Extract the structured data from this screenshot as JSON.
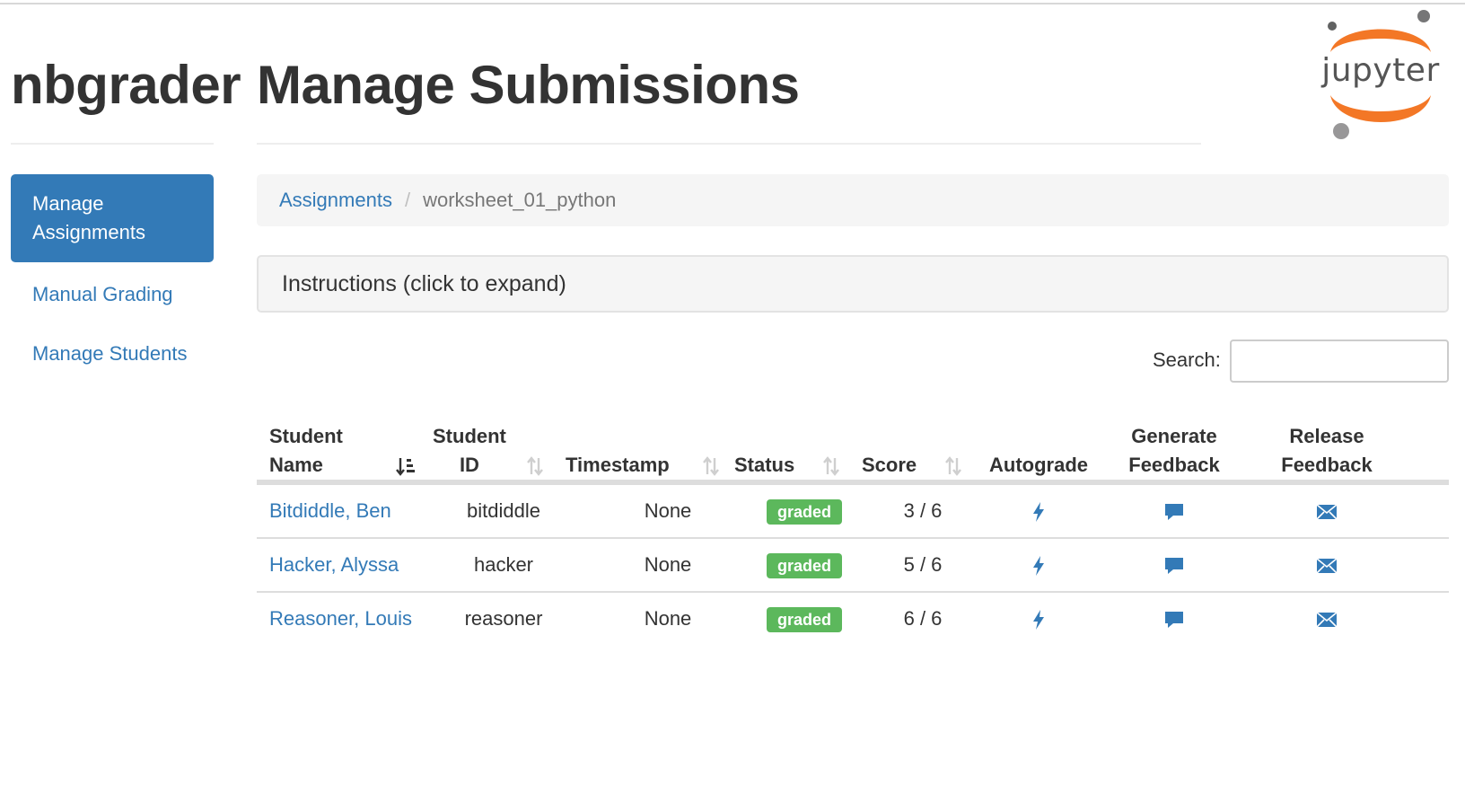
{
  "header": {
    "brand": "nbgrader",
    "title": "Manage Submissions",
    "logo_text": "jupyter"
  },
  "sidebar": {
    "items": [
      {
        "label": "Manage Assignments",
        "active": true
      },
      {
        "label": "Manual Grading",
        "active": false
      },
      {
        "label": "Manage Students",
        "active": false
      }
    ]
  },
  "breadcrumb": {
    "parent": "Assignments",
    "separator": "/",
    "current": "worksheet_01_python"
  },
  "instructions": {
    "label": "Instructions (click to expand)"
  },
  "search": {
    "label": "Search:",
    "value": "",
    "placeholder": ""
  },
  "table": {
    "columns": [
      {
        "label_line1": "Student",
        "label_line2": "Name",
        "sort": "ascending"
      },
      {
        "label_line1": "Student",
        "label_line2": "ID",
        "sort": "sortable"
      },
      {
        "label_line1": "",
        "label_line2": "Timestamp",
        "sort": "sortable"
      },
      {
        "label_line1": "",
        "label_line2": "Status",
        "sort": "sortable"
      },
      {
        "label_line1": "",
        "label_line2": "Score",
        "sort": "sortable"
      },
      {
        "label_line1": "",
        "label_line2": "Autograde",
        "sort": "none"
      },
      {
        "label_line1": "Generate",
        "label_line2": "Feedback",
        "sort": "none"
      },
      {
        "label_line1": "Release",
        "label_line2": "Feedback",
        "sort": "none"
      }
    ],
    "rows": [
      {
        "name": "Bitdiddle, Ben",
        "id": "bitdiddle",
        "timestamp": "None",
        "status": "graded",
        "score": "3 / 6"
      },
      {
        "name": "Hacker, Alyssa",
        "id": "hacker",
        "timestamp": "None",
        "status": "graded",
        "score": "5 / 6"
      },
      {
        "name": "Reasoner, Louis",
        "id": "reasoner",
        "timestamp": "None",
        "status": "graded",
        "score": "6 / 6"
      }
    ],
    "icons": {
      "autograde": "flash-icon",
      "generate_feedback": "comment-icon",
      "release_feedback": "envelope-icon"
    }
  },
  "colors": {
    "link": "#337ab7",
    "active_nav": "#337ab7",
    "badge_graded": "#5cb85c",
    "logo_orange": "#f37726",
    "logo_gray": "#767677"
  }
}
